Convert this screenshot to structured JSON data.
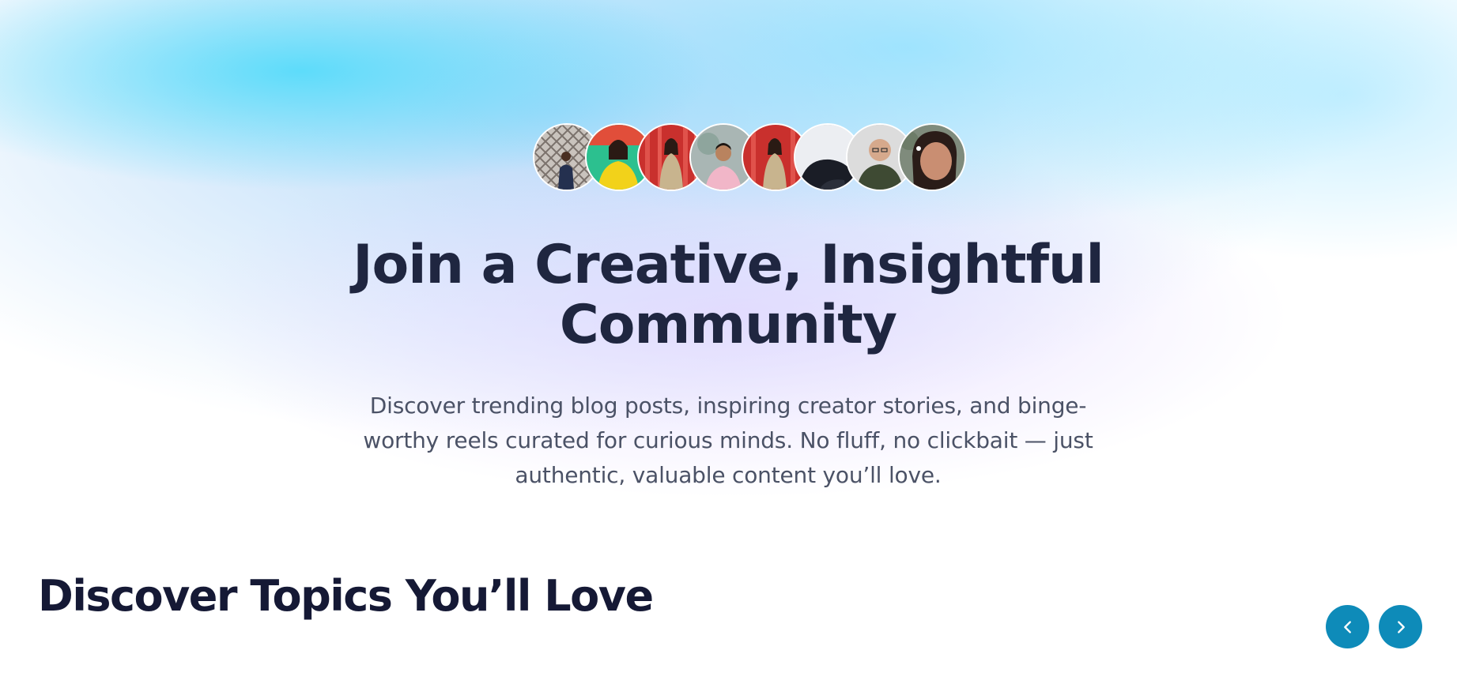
{
  "hero": {
    "title": "Join a Creative, Insightful Community",
    "subtitle": "Discover trending blog posts, inspiring creator stories, and binge-worthy reels curated for curious minds. No fluff, no clickbait — just authentic, valuable content you’ll love.",
    "avatars": [
      {
        "icon": "avatar-photo-creator-1",
        "bg": "#b8b2ad"
      },
      {
        "icon": "avatar-photo-creator-2",
        "bg": "#f2d21a"
      },
      {
        "icon": "avatar-photo-creator-3",
        "bg": "#d2332f"
      },
      {
        "icon": "avatar-photo-creator-4",
        "bg": "#aebcc0"
      },
      {
        "icon": "avatar-photo-creator-5",
        "bg": "#d2332f"
      },
      {
        "icon": "avatar-photo-creator-6",
        "bg": "#e7e9ee"
      },
      {
        "icon": "avatar-photo-creator-7",
        "bg": "#d9d9d9"
      },
      {
        "icon": "avatar-photo-creator-8",
        "bg": "#8a8f86"
      }
    ]
  },
  "topics": {
    "title": "Discover Topics You’ll Love",
    "prev_icon": "chevron-left-icon",
    "next_icon": "chevron-right-icon"
  },
  "colors": {
    "heading": "#1f2640",
    "section_heading": "#151935",
    "body_text": "#4b5266",
    "accent": "#0e8bb9",
    "sky": "#49daf9",
    "lavender": "#e0d4ff"
  }
}
